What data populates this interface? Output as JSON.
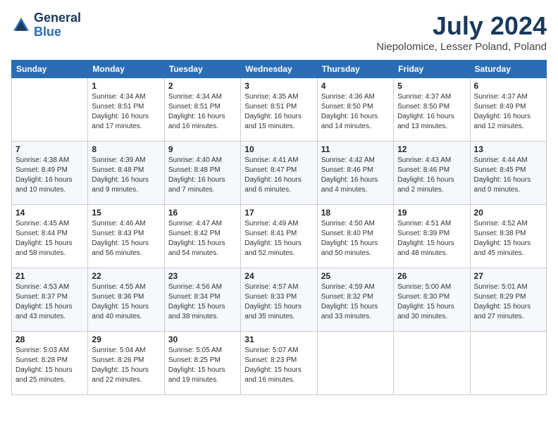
{
  "header": {
    "logo_line1": "General",
    "logo_line2": "Blue",
    "month_title": "July 2024",
    "location": "Niepolomice, Lesser Poland, Poland"
  },
  "days_of_week": [
    "Sunday",
    "Monday",
    "Tuesday",
    "Wednesday",
    "Thursday",
    "Friday",
    "Saturday"
  ],
  "weeks": [
    [
      {
        "day": "",
        "sunrise": "",
        "sunset": "",
        "daylight": ""
      },
      {
        "day": "1",
        "sunrise": "4:34 AM",
        "sunset": "8:51 PM",
        "daylight": "16 hours and 17 minutes."
      },
      {
        "day": "2",
        "sunrise": "4:34 AM",
        "sunset": "8:51 PM",
        "daylight": "16 hours and 16 minutes."
      },
      {
        "day": "3",
        "sunrise": "4:35 AM",
        "sunset": "8:51 PM",
        "daylight": "16 hours and 15 minutes."
      },
      {
        "day": "4",
        "sunrise": "4:36 AM",
        "sunset": "8:50 PM",
        "daylight": "16 hours and 14 minutes."
      },
      {
        "day": "5",
        "sunrise": "4:37 AM",
        "sunset": "8:50 PM",
        "daylight": "16 hours and 13 minutes."
      },
      {
        "day": "6",
        "sunrise": "4:37 AM",
        "sunset": "8:49 PM",
        "daylight": "16 hours and 12 minutes."
      }
    ],
    [
      {
        "day": "7",
        "sunrise": "4:38 AM",
        "sunset": "8:49 PM",
        "daylight": "16 hours and 10 minutes."
      },
      {
        "day": "8",
        "sunrise": "4:39 AM",
        "sunset": "8:48 PM",
        "daylight": "16 hours and 9 minutes."
      },
      {
        "day": "9",
        "sunrise": "4:40 AM",
        "sunset": "8:48 PM",
        "daylight": "16 hours and 7 minutes."
      },
      {
        "day": "10",
        "sunrise": "4:41 AM",
        "sunset": "8:47 PM",
        "daylight": "16 hours and 6 minutes."
      },
      {
        "day": "11",
        "sunrise": "4:42 AM",
        "sunset": "8:46 PM",
        "daylight": "16 hours and 4 minutes."
      },
      {
        "day": "12",
        "sunrise": "4:43 AM",
        "sunset": "8:46 PM",
        "daylight": "16 hours and 2 minutes."
      },
      {
        "day": "13",
        "sunrise": "4:44 AM",
        "sunset": "8:45 PM",
        "daylight": "16 hours and 0 minutes."
      }
    ],
    [
      {
        "day": "14",
        "sunrise": "4:45 AM",
        "sunset": "8:44 PM",
        "daylight": "15 hours and 58 minutes."
      },
      {
        "day": "15",
        "sunrise": "4:46 AM",
        "sunset": "8:43 PM",
        "daylight": "15 hours and 56 minutes."
      },
      {
        "day": "16",
        "sunrise": "4:47 AM",
        "sunset": "8:42 PM",
        "daylight": "15 hours and 54 minutes."
      },
      {
        "day": "17",
        "sunrise": "4:49 AM",
        "sunset": "8:41 PM",
        "daylight": "15 hours and 52 minutes."
      },
      {
        "day": "18",
        "sunrise": "4:50 AM",
        "sunset": "8:40 PM",
        "daylight": "15 hours and 50 minutes."
      },
      {
        "day": "19",
        "sunrise": "4:51 AM",
        "sunset": "8:39 PM",
        "daylight": "15 hours and 48 minutes."
      },
      {
        "day": "20",
        "sunrise": "4:52 AM",
        "sunset": "8:38 PM",
        "daylight": "15 hours and 45 minutes."
      }
    ],
    [
      {
        "day": "21",
        "sunrise": "4:53 AM",
        "sunset": "8:37 PM",
        "daylight": "15 hours and 43 minutes."
      },
      {
        "day": "22",
        "sunrise": "4:55 AM",
        "sunset": "8:36 PM",
        "daylight": "15 hours and 40 minutes."
      },
      {
        "day": "23",
        "sunrise": "4:56 AM",
        "sunset": "8:34 PM",
        "daylight": "15 hours and 38 minutes."
      },
      {
        "day": "24",
        "sunrise": "4:57 AM",
        "sunset": "8:33 PM",
        "daylight": "15 hours and 35 minutes."
      },
      {
        "day": "25",
        "sunrise": "4:59 AM",
        "sunset": "8:32 PM",
        "daylight": "15 hours and 33 minutes."
      },
      {
        "day": "26",
        "sunrise": "5:00 AM",
        "sunset": "8:30 PM",
        "daylight": "15 hours and 30 minutes."
      },
      {
        "day": "27",
        "sunrise": "5:01 AM",
        "sunset": "8:29 PM",
        "daylight": "15 hours and 27 minutes."
      }
    ],
    [
      {
        "day": "28",
        "sunrise": "5:03 AM",
        "sunset": "8:28 PM",
        "daylight": "15 hours and 25 minutes."
      },
      {
        "day": "29",
        "sunrise": "5:04 AM",
        "sunset": "8:26 PM",
        "daylight": "15 hours and 22 minutes."
      },
      {
        "day": "30",
        "sunrise": "5:05 AM",
        "sunset": "8:25 PM",
        "daylight": "15 hours and 19 minutes."
      },
      {
        "day": "31",
        "sunrise": "5:07 AM",
        "sunset": "8:23 PM",
        "daylight": "15 hours and 16 minutes."
      },
      {
        "day": "",
        "sunrise": "",
        "sunset": "",
        "daylight": ""
      },
      {
        "day": "",
        "sunrise": "",
        "sunset": "",
        "daylight": ""
      },
      {
        "day": "",
        "sunrise": "",
        "sunset": "",
        "daylight": ""
      }
    ]
  ],
  "labels": {
    "sunrise_prefix": "Sunrise: ",
    "sunset_prefix": "Sunset: ",
    "daylight_prefix": "Daylight: "
  }
}
